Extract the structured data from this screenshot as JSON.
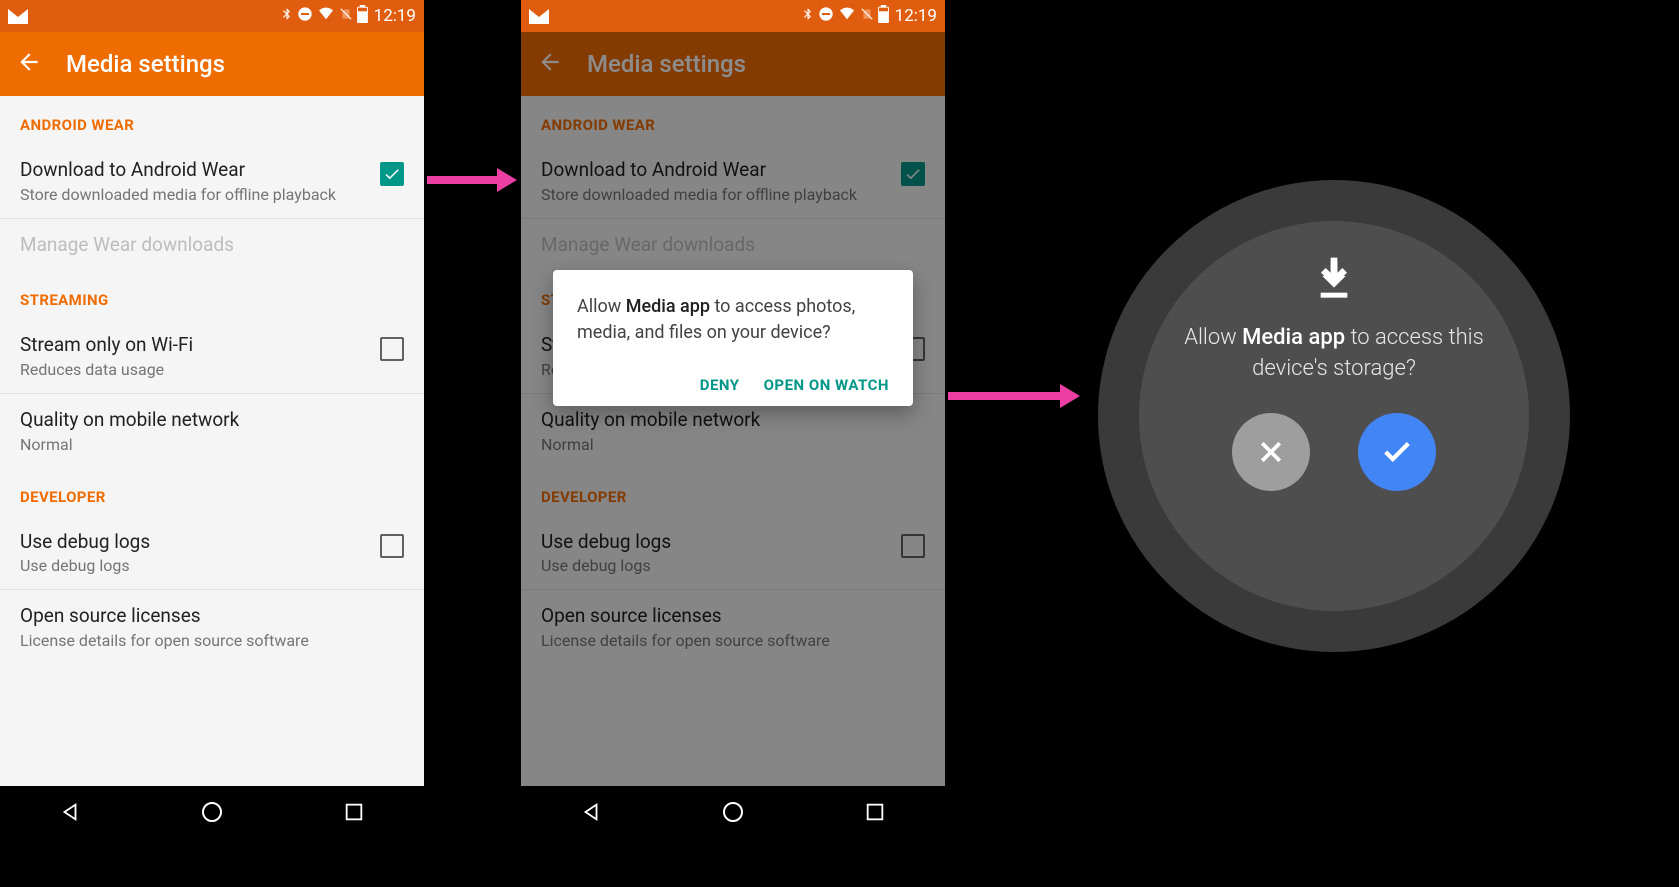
{
  "status": {
    "time": "12:19"
  },
  "appbar": {
    "title": "Media settings"
  },
  "sections": {
    "wear_header": "ANDROID WEAR",
    "download_wear_title": "Download to Android Wear",
    "download_wear_sub": "Store downloaded media for offline playback",
    "manage_wear": "Manage Wear downloads",
    "streaming_header": "STREAMING",
    "wifi_title": "Stream only on Wi-Fi",
    "wifi_sub": "Reduces data usage",
    "quality_title": "Quality on mobile network",
    "quality_sub": "Normal",
    "developer_header": "DEVELOPER",
    "debug_title": "Use debug logs",
    "debug_sub": "Use debug logs",
    "oss_title": "Open source licenses",
    "oss_sub": "License details for open source software"
  },
  "dialog": {
    "pre": "Allow ",
    "app": "Media app",
    "post": " to access photos, media, and files on your device?",
    "deny": "DENY",
    "open": "OPEN ON WATCH"
  },
  "watch": {
    "pre": "Allow ",
    "app": "Media app",
    "post": " to access this device's storage?"
  }
}
